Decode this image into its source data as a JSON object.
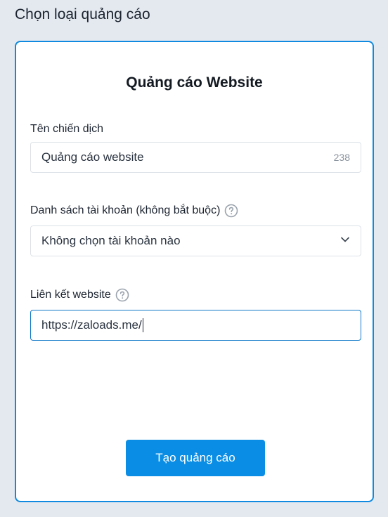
{
  "header": {
    "title": "Chọn loại quảng cáo"
  },
  "card": {
    "title": "Quảng cáo Website",
    "campaign_name": {
      "label": "Tên chiến dịch",
      "value": "Quảng cáo website",
      "char_count": "238"
    },
    "account_list": {
      "label": "Danh sách tài khoản (không bắt buộc)",
      "selected": "Không chọn tài khoản nào"
    },
    "website_link": {
      "label": "Liên kết website",
      "value": "https://zaloads.me/"
    },
    "submit_label": "Tạo quảng cáo"
  },
  "icons": {
    "help": "question-circle-icon",
    "dropdown": "chevron-down-icon"
  },
  "colors": {
    "accent": "#0a8de4",
    "card_border": "#0f8ae0",
    "background": "#e4e9f0"
  }
}
